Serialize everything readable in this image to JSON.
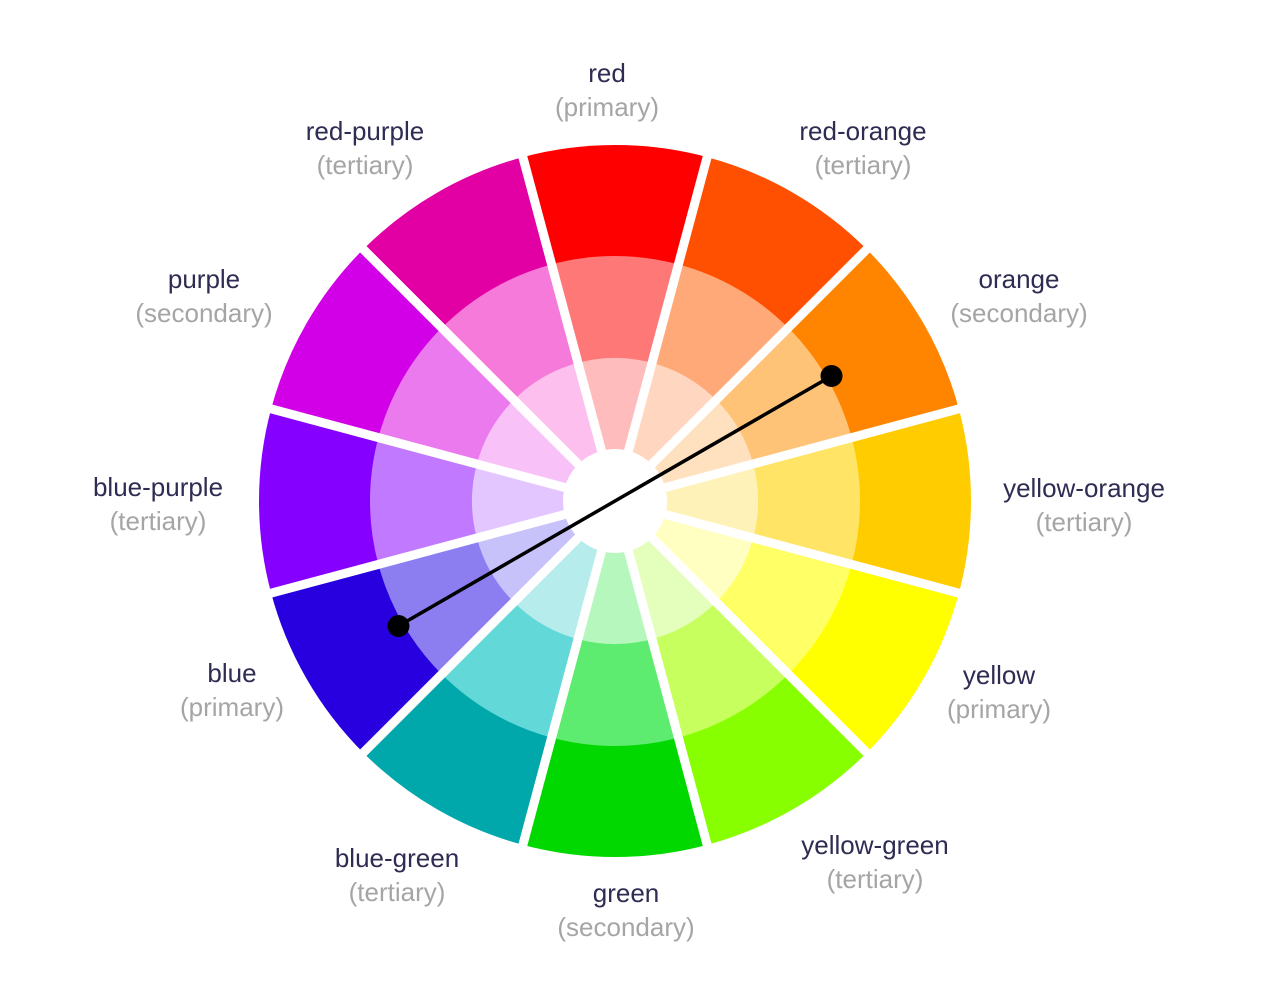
{
  "segments": [
    {
      "name": "red",
      "kind": "(primary)",
      "colors": [
        "#ff0000",
        "#ff7878",
        "#ffbcbc"
      ]
    },
    {
      "name": "red-orange",
      "kind": "(tertiary)",
      "colors": [
        "#ff4f00",
        "#ffa978",
        "#ffd6bf"
      ]
    },
    {
      "name": "orange",
      "kind": "(secondary)",
      "colors": [
        "#ff8400",
        "#ffc377",
        "#ffe0bf"
      ]
    },
    {
      "name": "yellow-orange",
      "kind": "(tertiary)",
      "colors": [
        "#ffcc00",
        "#ffe466",
        "#fff2b8"
      ]
    },
    {
      "name": "yellow",
      "kind": "(primary)",
      "colors": [
        "#ffff00",
        "#ffff66",
        "#ffffc2"
      ]
    },
    {
      "name": "yellow-green",
      "kind": "(tertiary)",
      "colors": [
        "#88ff00",
        "#c6ff5e",
        "#e4ffbc"
      ]
    },
    {
      "name": "green",
      "kind": "(secondary)",
      "colors": [
        "#00d800",
        "#5eec70",
        "#b6f7bd"
      ]
    },
    {
      "name": "blue-green",
      "kind": "(tertiary)",
      "colors": [
        "#00a8ab",
        "#62d8d8",
        "#b6ecec"
      ]
    },
    {
      "name": "blue",
      "kind": "(primary)",
      "colors": [
        "#2800df",
        "#8c7ef0",
        "#c8c2fa"
      ]
    },
    {
      "name": "blue-purple",
      "kind": "(tertiary)",
      "colors": [
        "#8500ff",
        "#c17aff",
        "#e3c6ff"
      ]
    },
    {
      "name": "purple",
      "kind": "(secondary)",
      "colors": [
        "#d200e6",
        "#ec7aef",
        "#f8c2f9"
      ]
    },
    {
      "name": "red-purple",
      "kind": "(tertiary)",
      "colors": [
        "#e200a4",
        "#f67ad9",
        "#fdc0ee"
      ]
    }
  ],
  "connector": {
    "from": "orange",
    "to": "blue",
    "color": "#000000"
  }
}
